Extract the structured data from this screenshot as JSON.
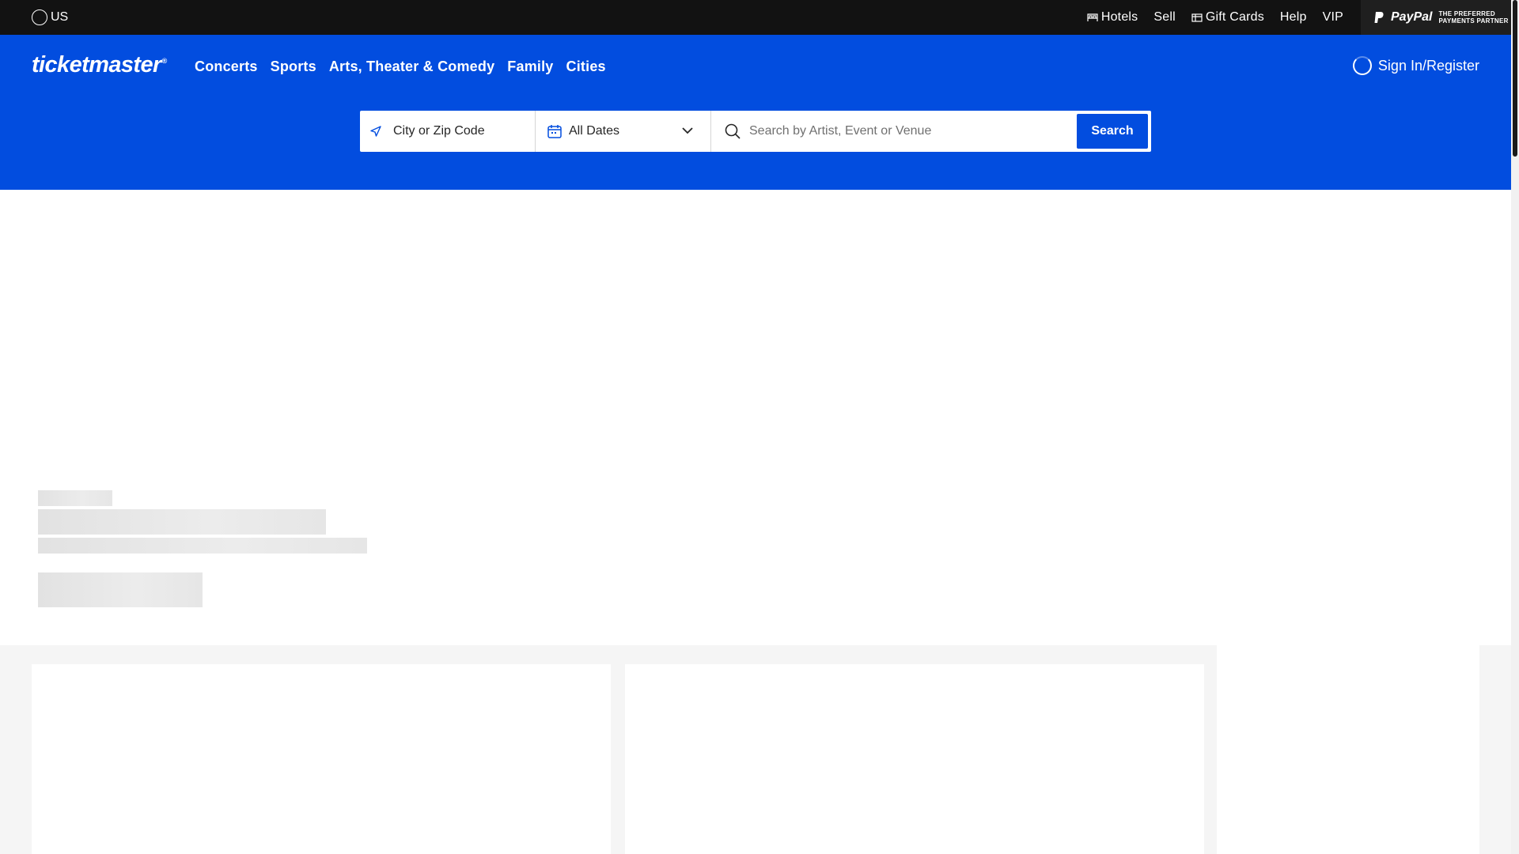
{
  "utility_bar": {
    "country": "US",
    "links": [
      {
        "label": "Hotels",
        "icon": "bed-icon"
      },
      {
        "label": "Sell",
        "icon": ""
      },
      {
        "label": "Gift Cards",
        "icon": "gift-card-icon"
      },
      {
        "label": "Help",
        "icon": ""
      },
      {
        "label": "VIP",
        "icon": ""
      }
    ],
    "paypal": {
      "brand": "PayPal",
      "tagline_1": "THE PREFERRED",
      "tagline_2": "PAYMENTS PARTNER"
    }
  },
  "header": {
    "logo": "ticketmaster",
    "logo_mark": "®",
    "nav": [
      "Concerts",
      "Sports",
      "Arts, Theater & Comedy",
      "Family",
      "Cities"
    ],
    "signin_label": "Sign In/Register"
  },
  "search": {
    "location_label": "City or Zip Code",
    "dates_label": "All Dates",
    "query_placeholder": "Search by Artist, Event or Venue",
    "button_label": "Search"
  },
  "colors": {
    "brand_blue": "#024ddf",
    "utility_black": "#121212",
    "skeleton_gray": "#e2e2e2",
    "panel_gray": "#f5f5f5"
  }
}
